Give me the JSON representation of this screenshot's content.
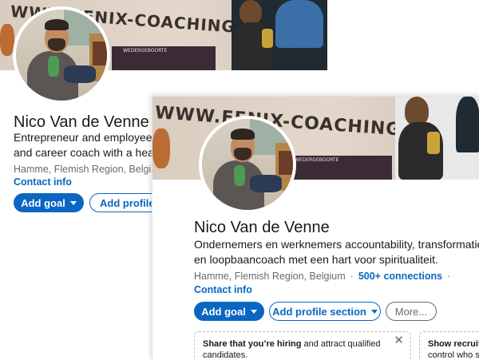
{
  "profile_back": {
    "banner_text": "WWW.FENIX-COACHING.COM",
    "name": "Nico Van de Venne",
    "headline_line1": "Entrepreneur and employee a",
    "headline_line2": "and career coach with a hear",
    "location": "Hamme, Flemish Region, Belgiu",
    "contact_info": "Contact info",
    "add_goal_label": "Add goal",
    "add_profile_label": "Add profile s"
  },
  "profile_front": {
    "banner_text": "WWW.FENIX-COACHING.COM",
    "name": "Nico Van de Venne",
    "headline_line1": "Ondernemers en werknemers accountability, transformatie",
    "headline_line2": "en loopbaancoach met een hart voor spiritualiteit.",
    "location": "Hamme, Flemish Region, Belgium",
    "connections": "500+ connections",
    "contact_info": "Contact info",
    "add_goal_label": "Add goal",
    "add_profile_label": "Add profile section",
    "more_label": "More...",
    "hiring_card": {
      "strong": "Share that you’re hiring",
      "rest": " and attract qualified",
      "line2": "candidates.",
      "close": "✕"
    },
    "recruiter_card": {
      "strong": "Show recruite",
      "line2": "control who s"
    }
  },
  "colors": {
    "accent": "#0a66c2",
    "muted_text": "#666666"
  },
  "icons": {
    "caret": "chevron-down-icon",
    "close": "close-icon"
  }
}
